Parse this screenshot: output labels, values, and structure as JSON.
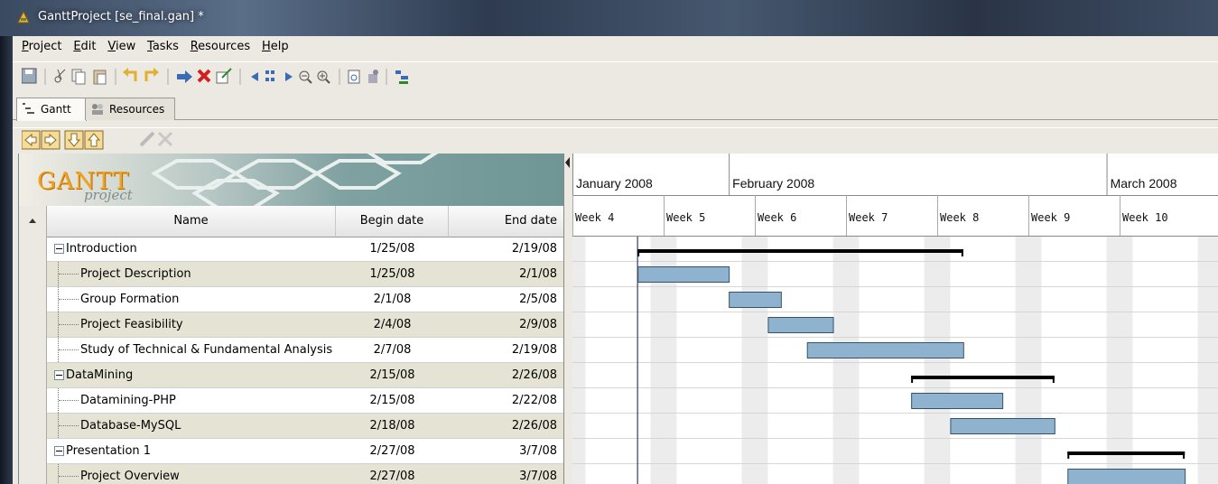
{
  "window": {
    "title": "GanttProject [se_final.gan] *"
  },
  "menu": [
    "Project",
    "Edit",
    "View",
    "Tasks",
    "Resources",
    "Help"
  ],
  "tabs": [
    {
      "label": "Gantt"
    },
    {
      "label": "Resources"
    }
  ],
  "logo": {
    "brand": "GANTT",
    "sub": "project"
  },
  "table": {
    "headers": {
      "name": "Name",
      "begin": "Begin date",
      "end": "End date"
    },
    "rows": [
      {
        "name": "Introduction",
        "begin": "1/25/08",
        "end": "2/19/08",
        "level": 0
      },
      {
        "name": "Project Description",
        "begin": "1/25/08",
        "end": "2/1/08",
        "level": 1
      },
      {
        "name": "Group Formation",
        "begin": "2/1/08",
        "end": "2/5/08",
        "level": 1
      },
      {
        "name": "Project Feasibility",
        "begin": "2/4/08",
        "end": "2/9/08",
        "level": 1
      },
      {
        "name": "Study of Technical & Fundamental Analysis",
        "begin": "2/7/08",
        "end": "2/19/08",
        "level": 1
      },
      {
        "name": "DataMining",
        "begin": "2/15/08",
        "end": "2/26/08",
        "level": 0
      },
      {
        "name": "Datamining-PHP",
        "begin": "2/15/08",
        "end": "2/22/08",
        "level": 1
      },
      {
        "name": "Database-MySQL",
        "begin": "2/18/08",
        "end": "2/26/08",
        "level": 1
      },
      {
        "name": "Presentation 1",
        "begin": "2/27/08",
        "end": "3/7/08",
        "level": 0
      },
      {
        "name": "Project Overview",
        "begin": "2/27/08",
        "end": "3/7/08",
        "level": 1
      }
    ]
  },
  "timeline": {
    "months": [
      "January 2008",
      "February 2008",
      "March 2008"
    ],
    "weeks": [
      "Week 4",
      "Week 5",
      "Week 6",
      "Week 7",
      "Week 8",
      "Week 9",
      "Week 10"
    ]
  },
  "colors": {
    "bar": "#8fb3cf",
    "bar_border": "#34536b",
    "summary": "#000000",
    "weekend": "#ececec"
  }
}
